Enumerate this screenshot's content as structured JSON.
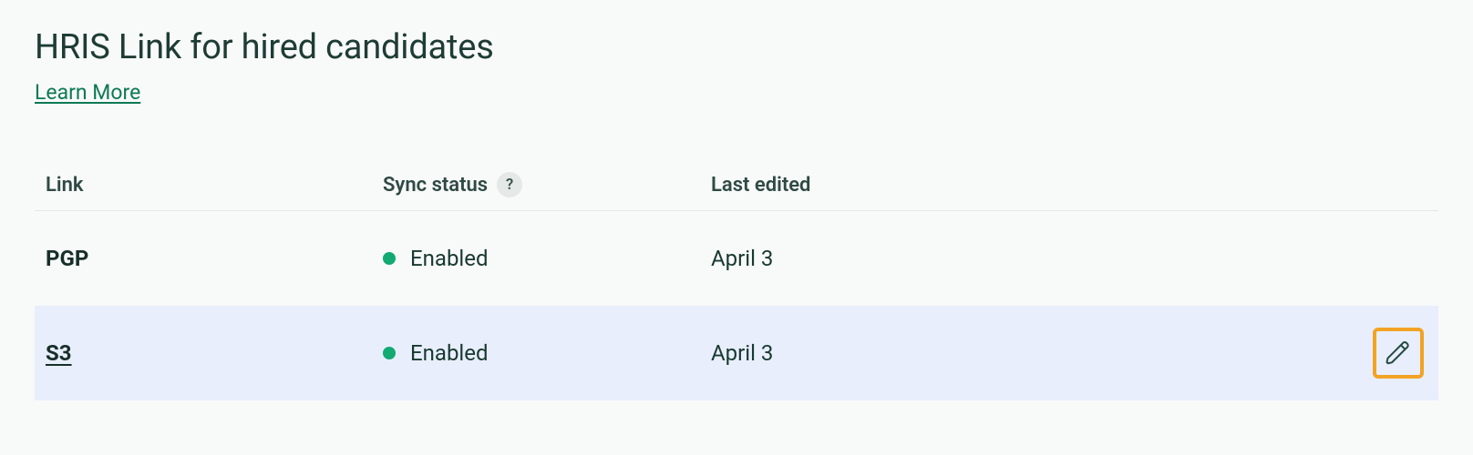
{
  "page": {
    "title": "HRIS Link for hired candidates",
    "learn_more": "Learn More"
  },
  "table": {
    "headers": {
      "link": "Link",
      "sync_status": "Sync status",
      "last_edited": "Last edited",
      "help_glyph": "?"
    },
    "rows": [
      {
        "name": "PGP",
        "underlined": false,
        "highlighted": false,
        "status_label": "Enabled",
        "status_color": "#12a973",
        "last_edited": "April 3",
        "show_edit": false
      },
      {
        "name": "S3",
        "underlined": true,
        "highlighted": true,
        "status_label": "Enabled",
        "status_color": "#12a973",
        "last_edited": "April 3",
        "show_edit": true
      }
    ]
  },
  "icons": {
    "edit_stroke": "#264b41"
  }
}
